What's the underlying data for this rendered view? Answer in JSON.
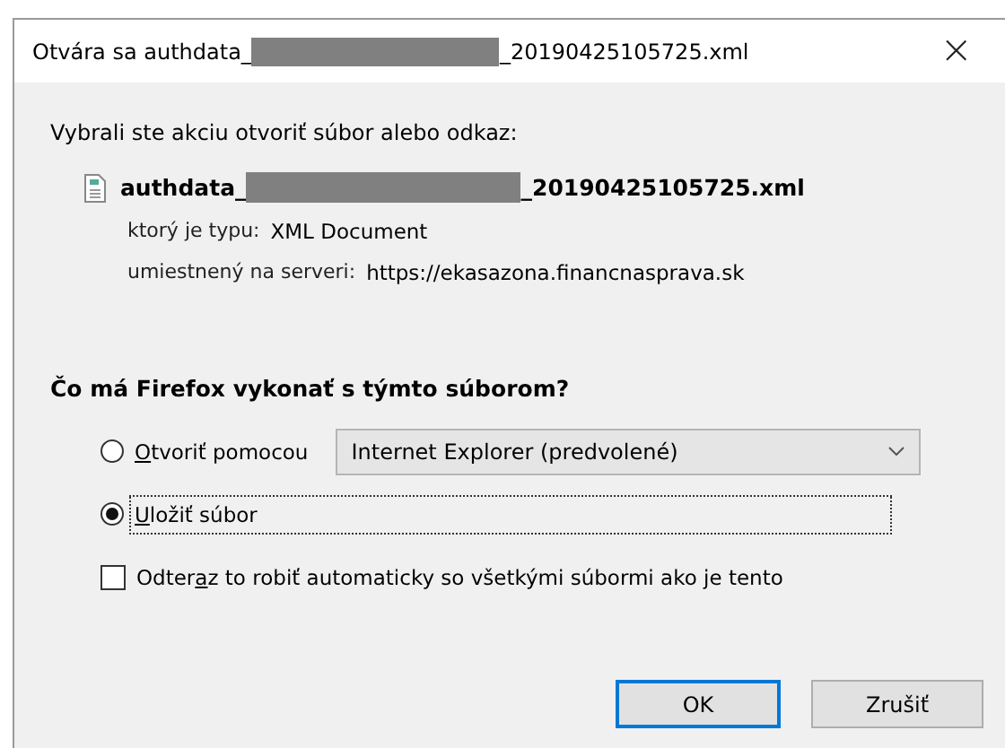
{
  "window": {
    "title_prefix": "Otvára sa authdata_",
    "title_suffix": "_20190425105725.xml",
    "close": "×"
  },
  "intro": "Vybrali ste akciu otvoriť súbor alebo odkaz:",
  "file": {
    "name_prefix": "authdata_",
    "name_suffix": "_20190425105725.xml",
    "details": [
      {
        "label": "ktorý je typu:",
        "value": "XML Document"
      },
      {
        "label": "umiestnený na serveri:",
        "value": "https://ekasazona.financnasprava.sk"
      }
    ]
  },
  "question": "Čo má Firefox vykonať s týmto súborom?",
  "options": [
    {
      "kind": "open",
      "key": "O",
      "after": "tvoriť pomocou",
      "selected": false,
      "focused": false,
      "app": "Internet Explorer (predvolené)"
    },
    {
      "kind": "save",
      "key": "U",
      "after": "ložiť súbor",
      "selected": true,
      "focused": true
    }
  ],
  "remember": {
    "before": "Odter",
    "key": "a",
    "after": "z to robiť automaticky so všetkými súbormi ako je tento",
    "checked": false
  },
  "buttons": [
    {
      "label": "OK",
      "default": true
    },
    {
      "label": "Zrušiť",
      "default": false
    }
  ]
}
